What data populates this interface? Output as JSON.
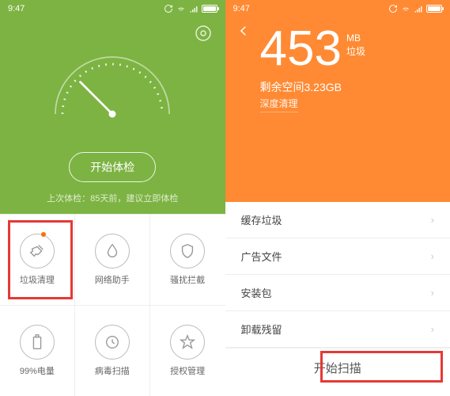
{
  "status": {
    "time": "9:47"
  },
  "left": {
    "start_button": "开始体检",
    "last_check": "上次体检：85天前，建议立即体检",
    "grid": [
      {
        "label": "垃圾清理",
        "icon": "broom-icon",
        "badge": true
      },
      {
        "label": "网络助手",
        "icon": "drop-icon",
        "badge": false
      },
      {
        "label": "骚扰拦截",
        "icon": "shield-icon",
        "badge": false
      },
      {
        "label": "99%电量",
        "icon": "battery-icon",
        "badge": false
      },
      {
        "label": "病毒扫描",
        "icon": "scan-icon",
        "badge": false
      },
      {
        "label": "授权管理",
        "icon": "star-icon",
        "badge": false
      }
    ]
  },
  "right": {
    "big_value": "453",
    "unit": "MB",
    "unit_sub": "垃圾",
    "space_prefix": "剩余空间",
    "space_value": "3.23GB",
    "deep_clean": "深度清理",
    "list": [
      "缓存垃圾",
      "广告文件",
      "安装包",
      "卸载残留"
    ],
    "scan_button": "开始扫描"
  },
  "colors": {
    "green": "#7cb342",
    "orange": "#ff8a33",
    "highlight": "#e53935"
  }
}
